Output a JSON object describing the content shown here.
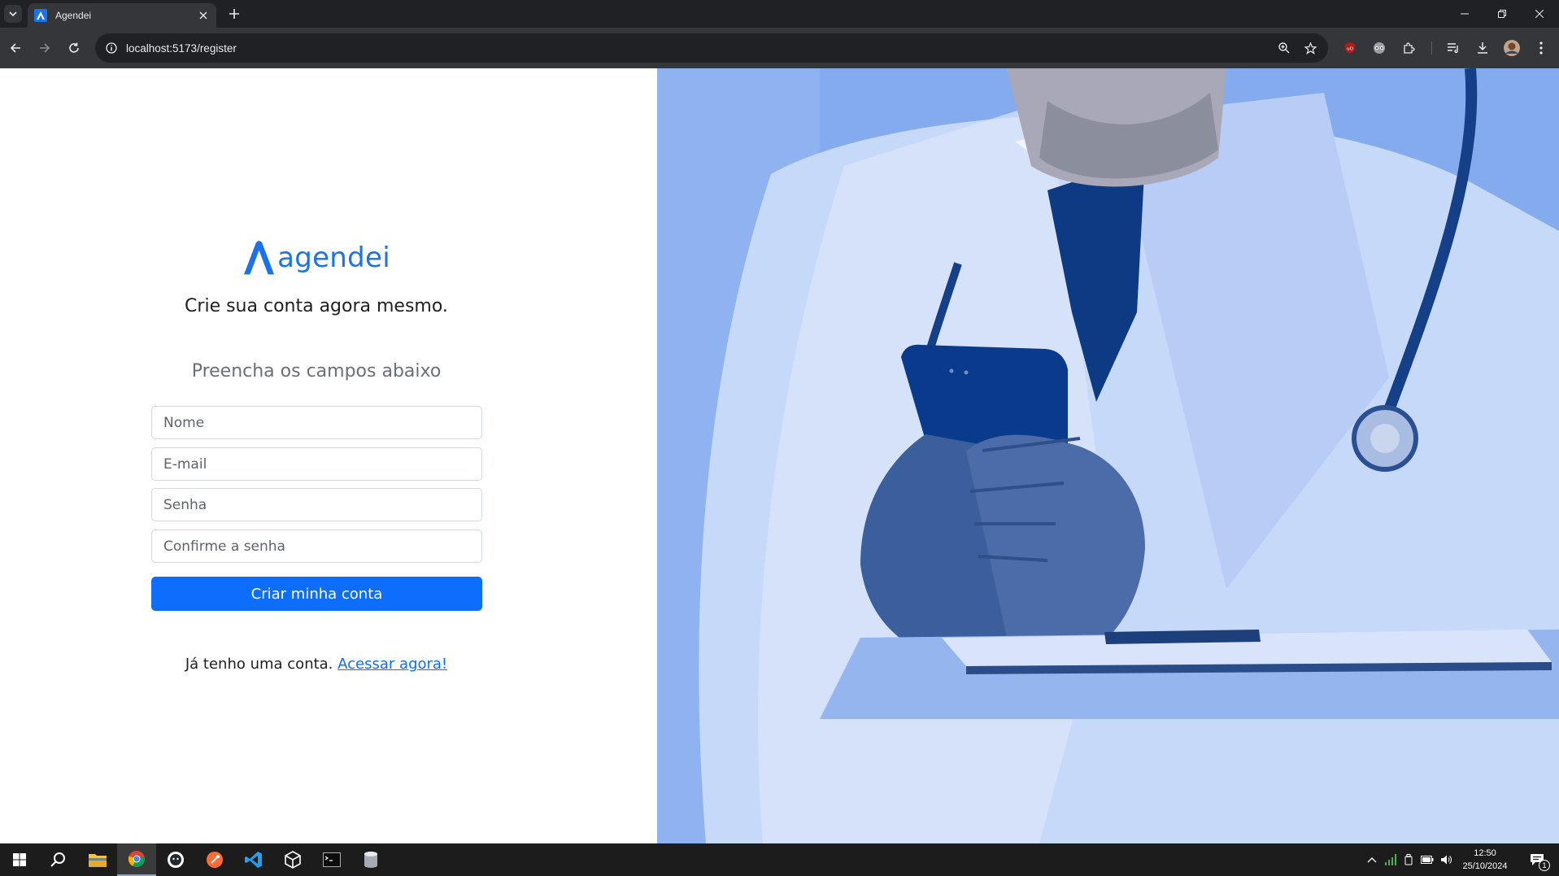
{
  "browser": {
    "tab_title": "Agendei",
    "url": "localhost:5173/register"
  },
  "page": {
    "logo_text": "agendei",
    "headline": "Crie sua conta agora mesmo.",
    "subhead": "Preencha os campos abaixo",
    "fields": [
      {
        "placeholder": "Nome"
      },
      {
        "placeholder": "E-mail"
      },
      {
        "placeholder": "Senha"
      },
      {
        "placeholder": "Confirme a senha"
      }
    ],
    "submit_label": "Criar minha conta",
    "footer_text": "Já tenho uma conta.",
    "footer_link": "Acessar agora!"
  },
  "taskbar": {
    "time": "12:50",
    "date": "25/10/2024",
    "notification_count": "1"
  },
  "colors": {
    "brand": "#1a73e8",
    "button": "#0d6efd",
    "hero_tint": "#7fa8ef"
  }
}
